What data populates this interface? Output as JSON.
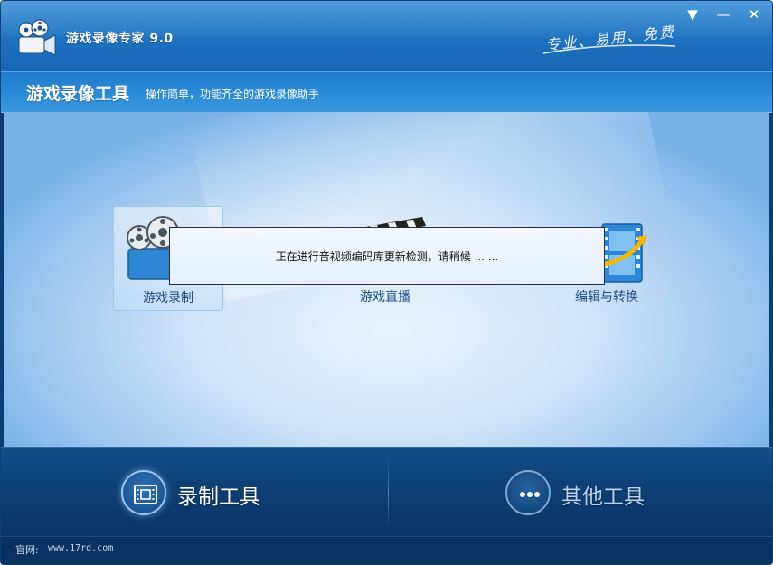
{
  "window": {
    "title": "游戏录像专家 9.0",
    "slogan": "专业、易用、免费",
    "controls": {
      "menu": "▼",
      "minimize": "—",
      "close": "✕"
    }
  },
  "header": {
    "section_title": "游戏录像工具",
    "section_desc": "操作简单，功能齐全的游戏录像助手"
  },
  "tools": [
    {
      "label": "游戏录制",
      "selected": true,
      "icon": "film-camera-icon"
    },
    {
      "label": "游戏直播",
      "selected": false,
      "icon": "clapperboard-icon"
    },
    {
      "label": "编辑与转换",
      "selected": false,
      "icon": "film-convert-icon"
    }
  ],
  "dialog": {
    "message": "正在进行音视频编码库更新检测，请稍候 ... ..."
  },
  "bottom_nav": [
    {
      "label": "录制工具",
      "icon": "film-icon",
      "active": true
    },
    {
      "label": "其他工具",
      "icon": "more-dots-icon",
      "active": false
    }
  ],
  "status": {
    "site_label": "官网:",
    "site_url": "www.17rd.com"
  },
  "colors": {
    "title_bar": "#1e72c0",
    "bottom_bar": "#0e3f76",
    "tool_label": "#1c4f86"
  }
}
